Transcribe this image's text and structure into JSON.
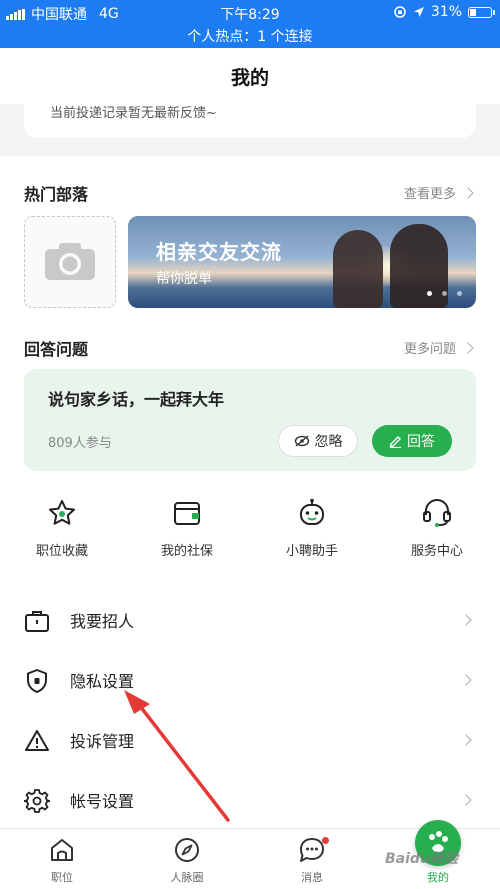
{
  "status_bar": {
    "carrier": "中国联通",
    "network": "4G",
    "time": "下午8:29",
    "battery": "31%",
    "battery_level": 0.31,
    "hotspot": "个人热点：1 个连接",
    "color": "#1e7cf2"
  },
  "header": {
    "title": "我的"
  },
  "feedback": {
    "text": "当前投递记录暂无最新反馈~"
  },
  "tribes": {
    "title": "热门部落",
    "more": "查看更多",
    "banner": {
      "title": "相亲交友交流",
      "subtitle": "帮你脱单"
    },
    "upload_icon": "camera-icon"
  },
  "questions": {
    "title": "回答问题",
    "more": "更多问题",
    "card": {
      "text": "说句家乡话，一起拜大年",
      "count": "809人参与",
      "ignore_label": "忽略",
      "answer_label": "回答"
    }
  },
  "shortcuts": [
    {
      "label": "职位收藏",
      "icon": "star-icon"
    },
    {
      "label": "我的社保",
      "icon": "wallet-icon"
    },
    {
      "label": "小聘助手",
      "icon": "robot-icon"
    },
    {
      "label": "服务中心",
      "icon": "headset-icon"
    }
  ],
  "menu": [
    {
      "label": "我要招人",
      "icon": "briefcase-icon"
    },
    {
      "label": "隐私设置",
      "icon": "shield-icon"
    },
    {
      "label": "投诉管理",
      "icon": "warning-icon"
    },
    {
      "label": "帐号设置",
      "icon": "gear-icon"
    }
  ],
  "tabbar": [
    {
      "label": "职位",
      "icon": "home-icon"
    },
    {
      "label": "人脉圈",
      "icon": "compass-icon"
    },
    {
      "label": "消息",
      "icon": "chat-icon"
    },
    {
      "label": "我的",
      "icon": "profile-icon"
    }
  ],
  "watermark": "Baidu经验",
  "colors": {
    "accent": "#27ae4e",
    "card_bg": "#e8f5ec",
    "annotation_arrow": "#e53935"
  }
}
